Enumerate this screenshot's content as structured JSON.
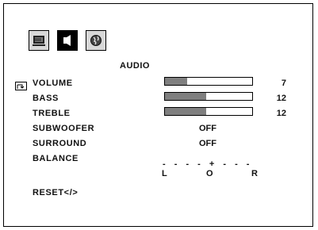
{
  "tabs": [
    {
      "name": "picture",
      "icon": "monitor-icon",
      "active": false
    },
    {
      "name": "audio",
      "icon": "speaker-icon",
      "active": true
    },
    {
      "name": "setup",
      "icon": "globe-icon",
      "active": false
    }
  ],
  "section_title": "AUDIO",
  "items": {
    "volume": {
      "label": "VOLUME",
      "value": "7",
      "level": 0.25
    },
    "bass": {
      "label": "BASS",
      "value": "12",
      "level": 0.47
    },
    "treble": {
      "label": "TREBLE",
      "value": "12",
      "level": 0.47
    },
    "subwoofer": {
      "label": "SUBWOOFER",
      "value": "OFF"
    },
    "surround": {
      "label": "SURROUND",
      "value": "OFF"
    },
    "balance": {
      "label": "BALANCE",
      "scale": "- - - - + - - -",
      "left": "L",
      "center": "O",
      "right": "R"
    },
    "reset": {
      "label": "RESET</>"
    }
  },
  "colors": {
    "bar_fill": "#7f7f7f",
    "active_tab": "#000000",
    "inactive_tab": "#d8d8d8"
  }
}
